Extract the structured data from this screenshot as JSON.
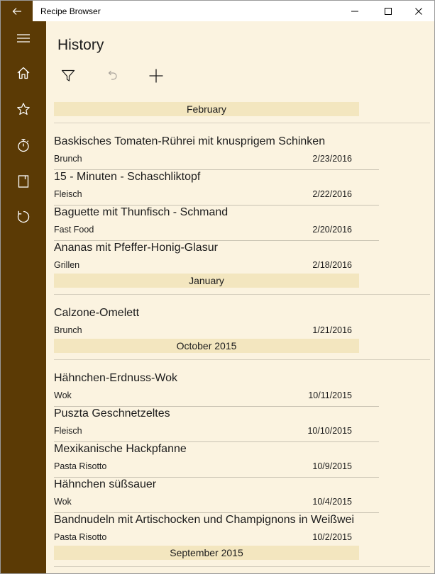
{
  "window": {
    "title": "Recipe Browser"
  },
  "page": {
    "title": "History"
  },
  "sidebar": {
    "items": [
      {
        "icon": "hamburger-icon"
      },
      {
        "icon": "home-icon"
      },
      {
        "icon": "star-icon"
      },
      {
        "icon": "timer-icon"
      },
      {
        "icon": "notebook-icon"
      },
      {
        "icon": "history-icon"
      }
    ]
  },
  "toolbar": {
    "filter_icon": "filter-icon",
    "undo_icon": "undo-icon",
    "add_icon": "add-icon"
  },
  "colors": {
    "sidebar": "#5b3a05",
    "background": "#fbf3e0",
    "group_header": "#f3e6bf"
  },
  "groups": [
    {
      "header": "February",
      "items": [
        {
          "title": "Baskisches Tomaten-Rührei mit knusprigem Schinken",
          "category": "Brunch",
          "date": "2/23/2016"
        },
        {
          "title": "15 - Minuten - Schaschliktopf",
          "category": "Fleisch",
          "date": "2/22/2016"
        },
        {
          "title": "Baguette mit Thunfisch - Schmand",
          "category": "Fast Food",
          "date": "2/20/2016"
        },
        {
          "title": "Ananas mit Pfeffer-Honig-Glasur",
          "category": "Grillen",
          "date": "2/18/2016"
        }
      ]
    },
    {
      "header": "January",
      "items": [
        {
          "title": "Calzone-Omelett",
          "category": "Brunch",
          "date": "1/21/2016"
        }
      ]
    },
    {
      "header": "October 2015",
      "items": [
        {
          "title": "Hähnchen-Erdnuss-Wok",
          "category": "Wok",
          "date": "10/11/2015"
        },
        {
          "title": "Puszta Geschnetzeltes",
          "category": "Fleisch",
          "date": "10/10/2015"
        },
        {
          "title": "Mexikanische Hackpfanne",
          "category": "Pasta Risotto",
          "date": "10/9/2015"
        },
        {
          "title": "Hähnchen süßsauer",
          "category": "Wok",
          "date": "10/4/2015"
        },
        {
          "title": "Bandnudeln mit Artischocken und Champignons in Weißwei",
          "category": "Pasta Risotto",
          "date": "10/2/2015"
        }
      ]
    },
    {
      "header": "September 2015",
      "items": []
    }
  ]
}
